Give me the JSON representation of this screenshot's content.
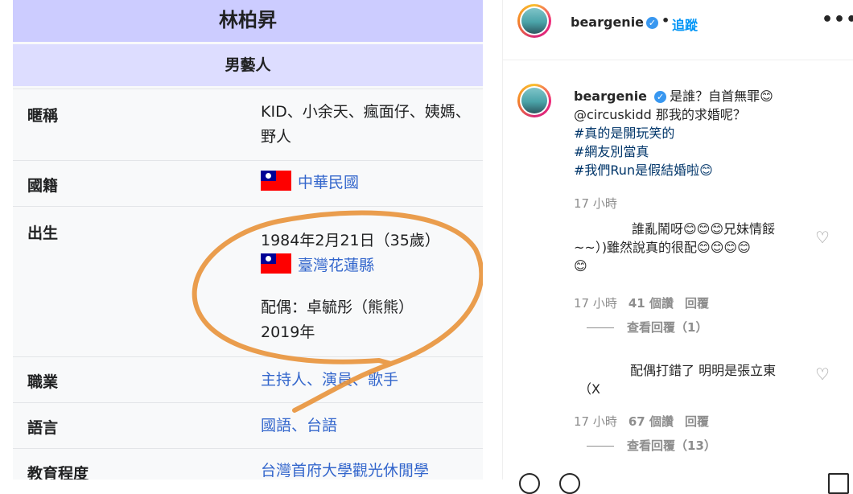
{
  "wiki": {
    "title": "林柏昇",
    "subtitle": "男藝人",
    "rows": [
      {
        "label": "暱稱",
        "value": "KID、小余天、瘋面仔、姨媽、野人"
      },
      {
        "label": "國籍",
        "value": "中華民國"
      },
      {
        "label": "出生",
        "birth_date": "1984年2月21日（35歲）",
        "birth_place": "臺灣花蓮縣",
        "spouse": "配偶：卓毓彤（熊熊）",
        "spouse_year": "2019年"
      },
      {
        "label": "職業",
        "value": "主持人、演員、歌手"
      },
      {
        "label": "語言",
        "value": "國語、台語"
      },
      {
        "label": "教育程度",
        "value": "台灣首府大學觀光休閒學"
      }
    ],
    "annotation_color": "#e8923a"
  },
  "instagram": {
    "header": {
      "username": "beargenie",
      "follow": "追蹤",
      "more": "•••",
      "separator": "•"
    },
    "caption": {
      "username": "beargenie",
      "text": "是誰？自首無罪😊",
      "line2": "@circuskidd 那我的求婚呢？",
      "tags": [
        "#真的是開玩笑的",
        "#網友別當真",
        "#我們Run是假結婚啦😊"
      ]
    },
    "caption_time": "17 小時",
    "comments": [
      {
        "text_line1": "誰亂鬧呀😊😊😊兄妹情餒",
        "text_line2": "~~）)雖然說真的很配😊😊😊😊",
        "text_line3": "😊",
        "time": "17 小時",
        "likes": "41 個讚",
        "reply": "回覆",
        "view_replies": "查看回覆（1）"
      },
      {
        "text_line1": "配偶打錯了 明明是張立東",
        "text_line2": "（X",
        "time": "17 小時",
        "likes": "67 個讚",
        "reply": "回覆",
        "view_replies": "查看回覆（13）"
      }
    ],
    "colors": {
      "link": "#0095f6",
      "hashtag": "#003569",
      "muted": "#8e8e8e",
      "verified": "#3897f0"
    }
  }
}
